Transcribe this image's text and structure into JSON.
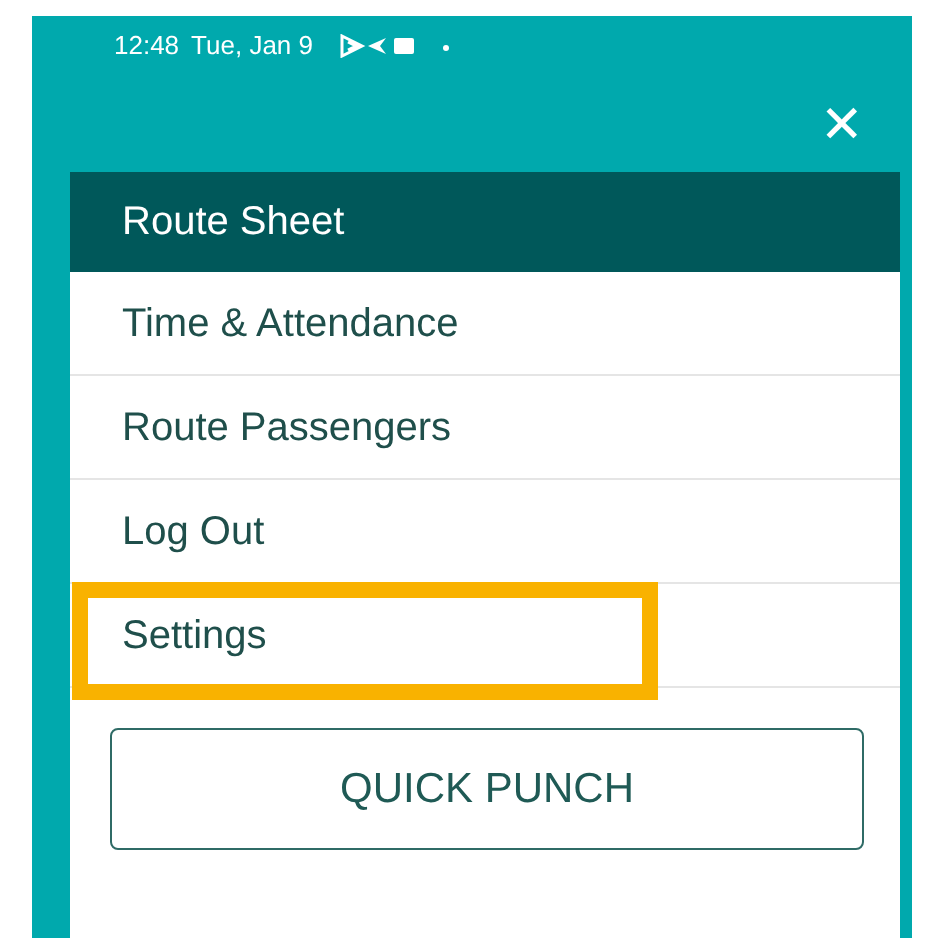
{
  "status_bar": {
    "time": "12:48",
    "date": "Tue, Jan 9"
  },
  "close_button": {
    "label": "✕"
  },
  "menu": {
    "items": [
      {
        "label": "Route Sheet",
        "selected": true,
        "highlighted": false
      },
      {
        "label": "Time & Attendance",
        "selected": false,
        "highlighted": false
      },
      {
        "label": "Route Passengers",
        "selected": false,
        "highlighted": false
      },
      {
        "label": "Log Out",
        "selected": false,
        "highlighted": false
      },
      {
        "label": "Settings",
        "selected": false,
        "highlighted": true
      }
    ]
  },
  "quick_punch_button": {
    "label": "QUICK PUNCH"
  }
}
